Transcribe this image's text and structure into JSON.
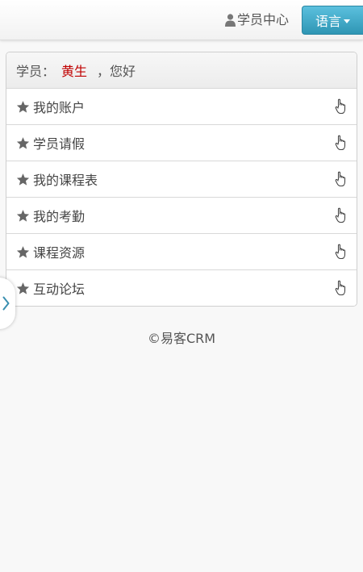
{
  "header": {
    "user_center_label": "学员中心",
    "language_label": "语言",
    "accent_color": "#39a9cc"
  },
  "panel": {
    "prefix": "学员：",
    "name": "黄生",
    "greeting": "，您好",
    "name_color": "#c00000",
    "items": [
      {
        "label": "我的账户"
      },
      {
        "label": "学员请假"
      },
      {
        "label": "我的课程表"
      },
      {
        "label": "我的考勤"
      },
      {
        "label": "课程资源"
      },
      {
        "label": "互动论坛"
      }
    ]
  },
  "footer": {
    "copyright": "©易客CRM"
  },
  "icons": {
    "user": "user-icon",
    "caret": "caret-down-icon",
    "star": "star-icon",
    "hand": "hand-pointer-icon",
    "chevron": "chevron-right-icon"
  }
}
